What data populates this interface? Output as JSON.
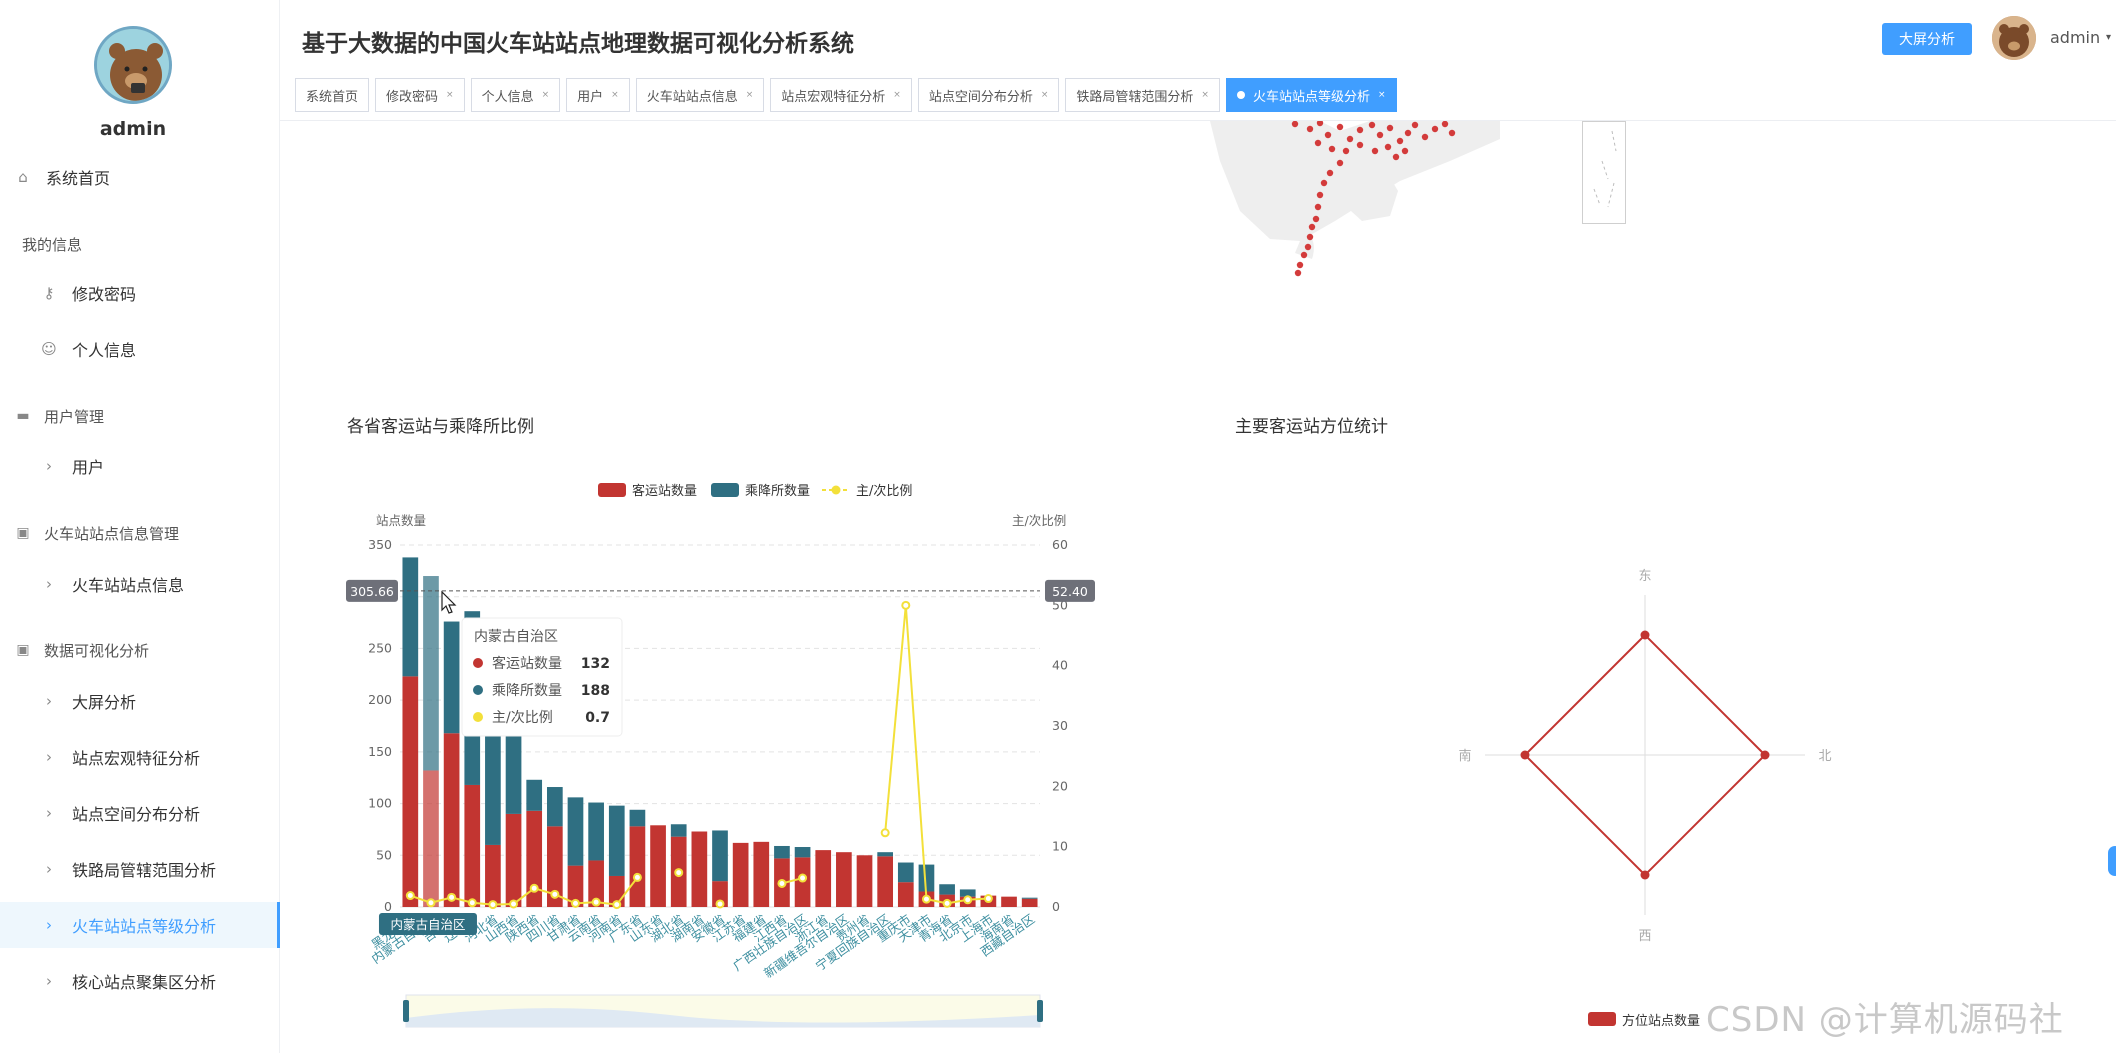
{
  "sidebar": {
    "username": "admin",
    "menu": [
      {
        "type": "item",
        "label": "系统首页",
        "icon": "home-icon",
        "y": 174,
        "indent": 0
      },
      {
        "type": "group",
        "label": "我的信息",
        "icon": "",
        "y": 244
      },
      {
        "type": "item",
        "label": "修改密码",
        "icon": "key-icon",
        "y": 290,
        "indent": 1
      },
      {
        "type": "item",
        "label": "个人信息",
        "icon": "user-icon",
        "y": 346,
        "indent": 1
      },
      {
        "type": "group",
        "label": "用户管理",
        "icon": "briefcase-icon",
        "y": 416
      },
      {
        "type": "item",
        "label": "用户",
        "icon": "chevron-right-icon",
        "y": 463,
        "indent": 1
      },
      {
        "type": "group",
        "label": "火车站站点信息管理",
        "icon": "clipboard-icon",
        "y": 533
      },
      {
        "type": "item",
        "label": "火车站站点信息",
        "icon": "chevron-right-icon",
        "y": 581,
        "indent": 1
      },
      {
        "type": "group",
        "label": "数据可视化分析",
        "icon": "clipboard-icon",
        "y": 650
      },
      {
        "type": "item",
        "label": "大屏分析",
        "icon": "chevron-right-icon",
        "y": 698,
        "indent": 1
      },
      {
        "type": "item",
        "label": "站点宏观特征分析",
        "icon": "chevron-right-icon",
        "y": 754,
        "indent": 1
      },
      {
        "type": "item",
        "label": "站点空间分布分析",
        "icon": "chevron-right-icon",
        "y": 810,
        "indent": 1
      },
      {
        "type": "item",
        "label": "铁路局管辖范围分析",
        "icon": "chevron-right-icon",
        "y": 866,
        "indent": 1
      },
      {
        "type": "item",
        "label": "火车站站点等级分析",
        "icon": "chevron-right-icon",
        "y": 922,
        "indent": 1,
        "active": true
      },
      {
        "type": "item",
        "label": "核心站点聚集区分析",
        "icon": "chevron-right-icon",
        "y": 978,
        "indent": 1
      }
    ]
  },
  "header": {
    "title": "基于大数据的中国火车站站点地理数据可视化分析系统",
    "big_screen_label": "大屏分析",
    "username": "admin",
    "caret": "▾"
  },
  "tabs": [
    {
      "label": "系统首页",
      "closable": false
    },
    {
      "label": "修改密码",
      "closable": true
    },
    {
      "label": "个人信息",
      "closable": true
    },
    {
      "label": "用户",
      "closable": true
    },
    {
      "label": "火车站站点信息",
      "closable": true
    },
    {
      "label": "站点宏观特征分析",
      "closable": true
    },
    {
      "label": "站点空间分布分析",
      "closable": true
    },
    {
      "label": "铁路局管辖范围分析",
      "closable": true
    },
    {
      "label": "火车站站点等级分析",
      "closable": true,
      "active": true
    }
  ],
  "tab_close": "×",
  "watermark": "CSDN @计算机源码社",
  "chart_data": [
    {
      "type": "bar",
      "title": "各省客运站与乘降所比例",
      "legend": [
        "客运站数量",
        "乘降所数量",
        "主/次比例"
      ],
      "ylabel": "站点数量",
      "ylabel_right": "主/次比例",
      "ylim": [
        0,
        350
      ],
      "ylim_right": [
        0,
        60
      ],
      "yticks": [
        0,
        50,
        100,
        150,
        200,
        250,
        300,
        350
      ],
      "yticks_right": [
        0,
        10,
        20,
        30,
        40,
        50,
        60
      ],
      "categories": [
        "黑龙江省",
        "内蒙古自治区",
        "吉林省",
        "辽宁省",
        "河北省",
        "山西省",
        "陕西省",
        "四川省",
        "甘肃省",
        "云南省",
        "河南省",
        "山东省",
        "湖北省",
        "广东省",
        "湖南省",
        "安徽省",
        "江苏省",
        "福建省",
        "江西省",
        "广西壮族自治区",
        "浙江省",
        "新疆维吾尔自治区",
        "贵州省",
        "宁夏回族自治区",
        "重庆市",
        "天津市",
        "青海省",
        "北京市",
        "上海市",
        "海南省",
        "西藏自治区"
      ],
      "visible_tick_labels": [
        "黑龙江省",
        "内蒙古自治区",
        "吉林省",
        "辽宁省",
        "河北省",
        "山西省",
        "陕西省",
        "四川省",
        "甘肃省",
        "云南省",
        "河南省",
        "广东省",
        "山东省",
        "湖北省",
        "湖南省",
        "安徽省",
        "江苏省",
        "福建省",
        "江西省",
        "广西壮族自治区",
        "浙江省",
        "新疆维吾尔自治区",
        "贵州省",
        "宁夏回族自治区",
        "重庆市",
        "天津市",
        "青海省",
        "北京市",
        "上海市",
        "海南省",
        "西藏自治区"
      ],
      "series": [
        {
          "name": "客运站数量",
          "color": "#c23531",
          "values": [
            223,
            132,
            168,
            118,
            60,
            90,
            93,
            78,
            40,
            45,
            30,
            78,
            79,
            68,
            73,
            25,
            62,
            63,
            47,
            48,
            55,
            53,
            50,
            49,
            24,
            15,
            12,
            10,
            11,
            10,
            8
          ]
        },
        {
          "name": "乘降所数量",
          "color": "#2f6f82",
          "values": [
            115,
            188,
            108,
            168,
            168,
            172,
            30,
            38,
            66,
            56,
            68,
            16,
            0,
            12,
            0,
            49,
            0,
            0,
            12,
            10,
            0,
            0,
            0,
            4,
            19,
            26,
            10,
            7,
            0,
            0,
            1
          ]
        },
        {
          "name": "主/次比例",
          "color": "#f3e03a",
          "values": [
            1.9,
            0.7,
            1.6,
            0.7,
            0.4,
            0.5,
            3.1,
            2.1,
            0.6,
            0.8,
            0.4,
            4.9,
            null,
            5.7,
            null,
            0.5,
            null,
            null,
            3.9,
            4.8,
            null,
            null,
            null,
            12.3,
            50,
            1.3,
            0.6,
            1.2,
            1.4,
            null,
            null
          ]
        }
      ],
      "tooltip": {
        "title": "内蒙古自治区",
        "rows": [
          {
            "name": "客运站数量",
            "value": "132",
            "color": "#c23531"
          },
          {
            "name": "乘降所数量",
            "value": "188",
            "color": "#2f6f82"
          },
          {
            "name": "主/次比例",
            "value": "0.7",
            "color": "#f3e03a"
          }
        ]
      },
      "axis_pointer": {
        "left_value": "305.66",
        "right_value": "52.40",
        "category": "内蒙古自治区"
      }
    },
    {
      "type": "radar",
      "title": "主要客运站方位统计",
      "indicators": [
        "东",
        "北",
        "西",
        "南"
      ],
      "series": [
        {
          "name": "方位站点数量",
          "color": "#c23531",
          "values": [
            100,
            100,
            100,
            100
          ]
        }
      ],
      "legend": [
        "方位站点数量"
      ]
    }
  ]
}
